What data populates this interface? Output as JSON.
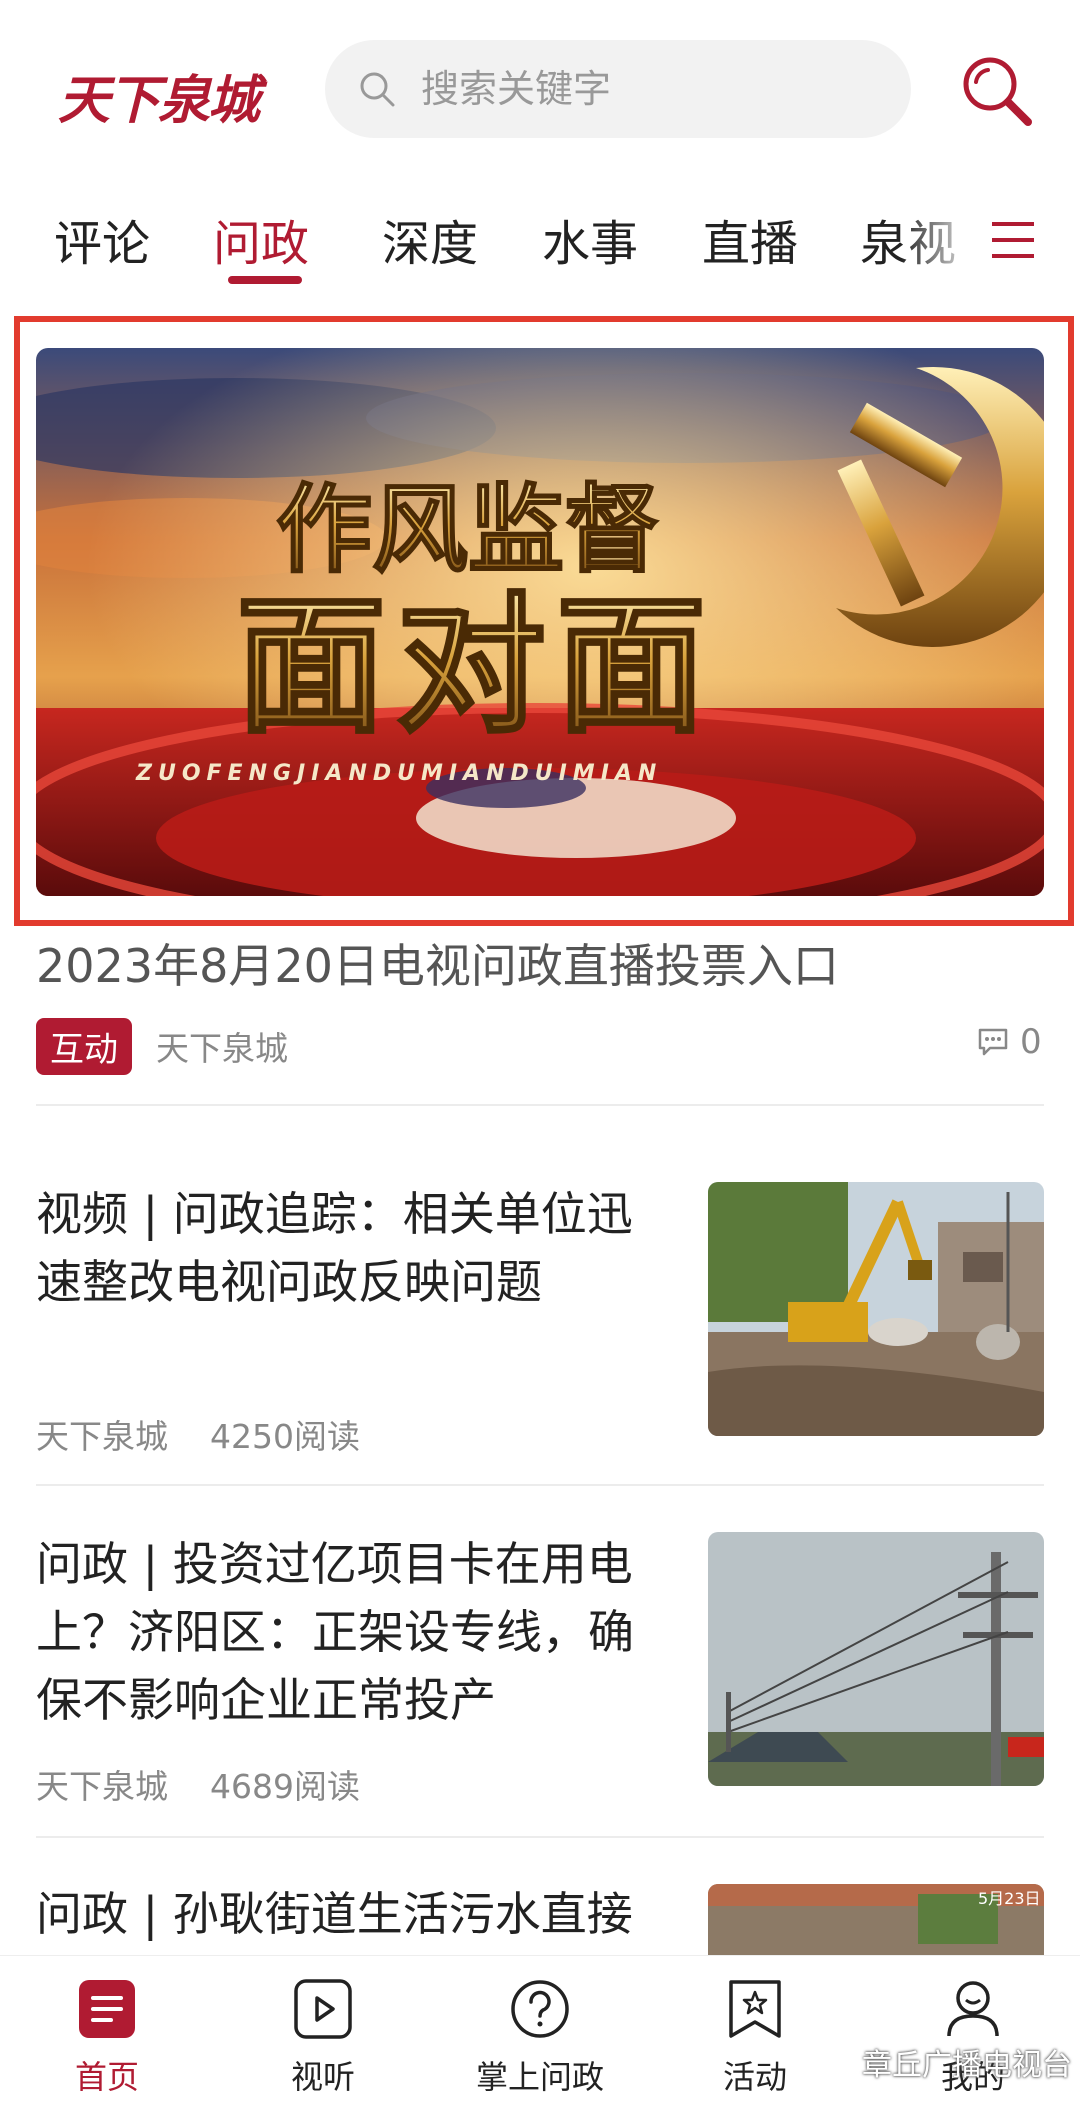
{
  "header": {
    "logo_text": "天下泉城",
    "search_placeholder": "搜索关键字"
  },
  "tabs": [
    {
      "label": "评论"
    },
    {
      "label": "问政"
    },
    {
      "label": "深度"
    },
    {
      "label": "水事"
    },
    {
      "label": "直播"
    },
    {
      "label": "泉视"
    }
  ],
  "banner": {
    "line1": "作风监督",
    "line2": "面对面",
    "pinyin": "ZUOFENGJIANDUMIANDUIMIAN"
  },
  "featured": {
    "title": "2023年8月20日电视问政直播投票入口",
    "badge": "互动",
    "source": "天下泉城",
    "comments": "0"
  },
  "articles": [
    {
      "title": "视频 | 问政追踪：相关单位迅速整改电视问政反映问题",
      "source": "天下泉城",
      "reads": "4250阅读"
    },
    {
      "title": "问政 | 投资过亿项目卡在用电上？济阳区：正架设专线，确保不影响企业正常投产",
      "source": "天下泉城",
      "reads": "4689阅读"
    },
    {
      "title": "问政 | 孙耿街道生活污水直接",
      "thumb_date": "5月23日"
    }
  ],
  "bottom_nav": [
    {
      "label": "首页"
    },
    {
      "label": "视听"
    },
    {
      "label": "掌上问政"
    },
    {
      "label": "活动"
    },
    {
      "label": "我的"
    }
  ],
  "watermark": "章丘广播电视台",
  "colors": {
    "brand": "#b01b32",
    "highlight_frame": "#e23b2e"
  }
}
